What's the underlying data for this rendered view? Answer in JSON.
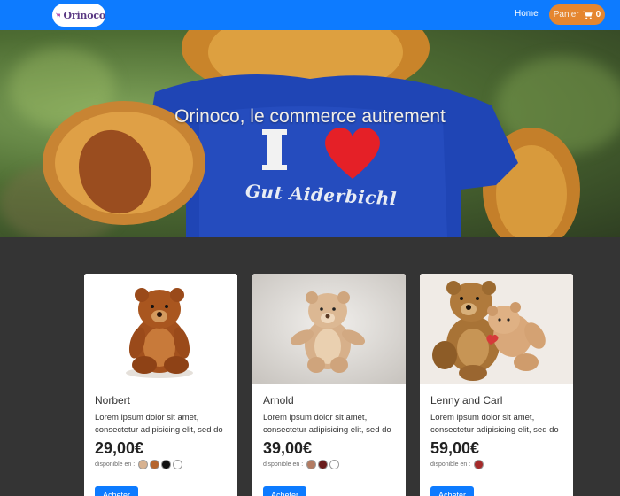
{
  "navbar": {
    "logo_text": "Orinoco",
    "home_label": "Home",
    "cart_label": "Panier",
    "cart_count": "0"
  },
  "hero": {
    "title": "Orinoco, le commerce autrement",
    "shirt_text": "Gut Aiderbichl"
  },
  "products": [
    {
      "name": "Norbert",
      "description": "Lorem ipsum dolor sit amet, consectetur adipisicing elit, sed do",
      "price": "29,00€",
      "availability_label": "disponible en :",
      "colors": [
        "#d7b291",
        "#b5652e",
        "#111111",
        "#ffffff"
      ],
      "buy_label": "Acheter"
    },
    {
      "name": "Arnold",
      "description": "Lorem ipsum dolor sit amet, consectetur adipisicing elit, sed do",
      "price": "39,00€",
      "availability_label": "disponible en :",
      "colors": [
        "#b27b62",
        "#6a1c1c",
        "#ffffff"
      ],
      "buy_label": "Acheter"
    },
    {
      "name": "Lenny and Carl",
      "description": "Lorem ipsum dolor sit amet, consectetur adipisicing elit, sed do",
      "price": "59,00€",
      "availability_label": "disponible en :",
      "colors": [
        "#a52a2a"
      ],
      "buy_label": "Acheter"
    }
  ],
  "icons": {
    "logo": "shopping-cart-icon",
    "cart": "shopping-cart-icon"
  },
  "colors": {
    "navbar": "#0d7bff",
    "cart_button": "#e5862f",
    "page_background": "#343434",
    "buy_button": "#0d7bff"
  }
}
